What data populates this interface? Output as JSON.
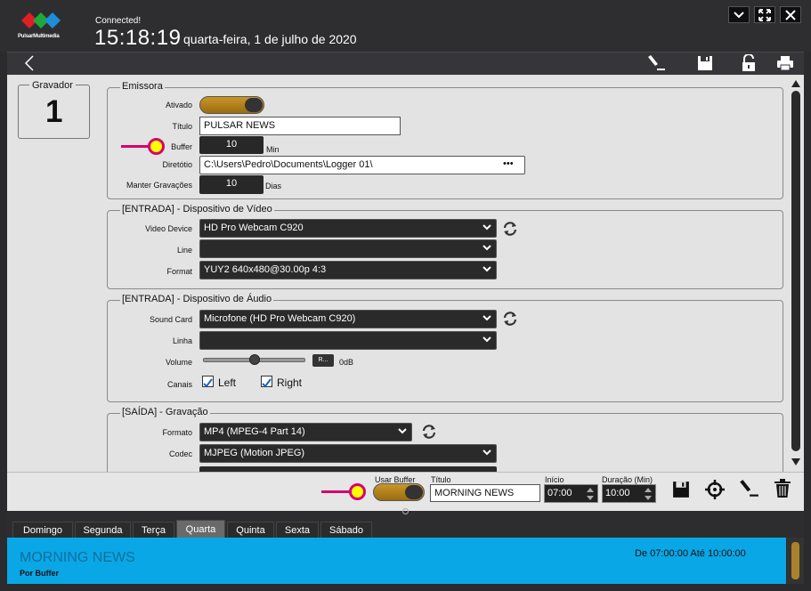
{
  "header": {
    "brand": "PulsarMultimedia",
    "status": "Connected!",
    "time": "15:18:19",
    "date": "quarta-feira, 1 de julho de 2020"
  },
  "window_controls": [
    "minimize-icon",
    "fullscreen-icon",
    "close-icon"
  ],
  "toolbar": {
    "icons": [
      "back-icon",
      "edit-icon",
      "save-icon",
      "unlock-icon",
      "print-icon"
    ]
  },
  "gravador": {
    "label": "Gravador",
    "number": "1"
  },
  "emissora": {
    "legend": "Emissora",
    "ativado_label": "Ativado",
    "titulo_label": "Título",
    "titulo_value": "PULSAR NEWS",
    "buffer_label": "Buffer",
    "buffer_value": "10",
    "buffer_unit": "Min",
    "diretorio_label": "Diretótio",
    "diretorio_value": "C:\\Users\\Pedro\\Documents\\Logger 01\\",
    "diretorio_browse": "•••",
    "manter_label": "Manter Gravações",
    "manter_value": "10",
    "manter_unit": "Dias"
  },
  "video": {
    "legend": "[ENTRADA] - Dispositivo de Vídeo",
    "device_label": "Video Device",
    "device_value": "HD Pro Webcam C920",
    "line_label": "Line",
    "line_value": "",
    "format_label": "Format",
    "format_value": "YUY2 640x480@30.00p 4:3"
  },
  "audio": {
    "legend": "[ENTRADA] - Dispositivo de Áudio",
    "sound_label": "Sound Card",
    "sound_value": "Microfone (HD Pro Webcam C920)",
    "linha_label": "Linha",
    "linha_value": "",
    "volume_label": "Volume",
    "volume_reset": "R...",
    "volume_value": "0dB",
    "volume_level": 0.5,
    "canais_label": "Canais",
    "left_label": "Left",
    "right_label": "Right",
    "left_checked": true,
    "right_checked": true
  },
  "saida": {
    "legend": "[SAÍDA] - Gravação",
    "formato_label": "Formato",
    "formato_value": "MP4 (MPEG-4 Part 14)",
    "codec_label": "Codec",
    "codec_value": "MJPEG (Motion JPEG)"
  },
  "schedule_bar": {
    "usar_buffer_label": "Usar Buffer",
    "titulo_label": "Título",
    "titulo_value": "MORNING NEWS",
    "inicio_label": "Início",
    "inicio_value": "07:00",
    "duracao_label": "Duração (Min)",
    "duracao_value": "10:00",
    "icons": [
      "save-icon",
      "target-icon",
      "edit-icon",
      "trash-icon"
    ]
  },
  "tabs": [
    {
      "label": "Domingo",
      "active": false
    },
    {
      "label": "Segunda",
      "active": false
    },
    {
      "label": "Terça",
      "active": false
    },
    {
      "label": "Quarta",
      "active": true
    },
    {
      "label": "Quinta",
      "active": false
    },
    {
      "label": "Sexta",
      "active": false
    },
    {
      "label": "Sábado",
      "active": false
    }
  ],
  "events": [
    {
      "title": "MORNING NEWS",
      "subtitle": "Por Buffer",
      "time": "De 07:00:00 Até 10:00:00"
    }
  ],
  "colors": {
    "accent": "#0aa7e6",
    "toggle": "#c9962a",
    "marker": "#d4006e",
    "highlight": "#ffff00"
  }
}
